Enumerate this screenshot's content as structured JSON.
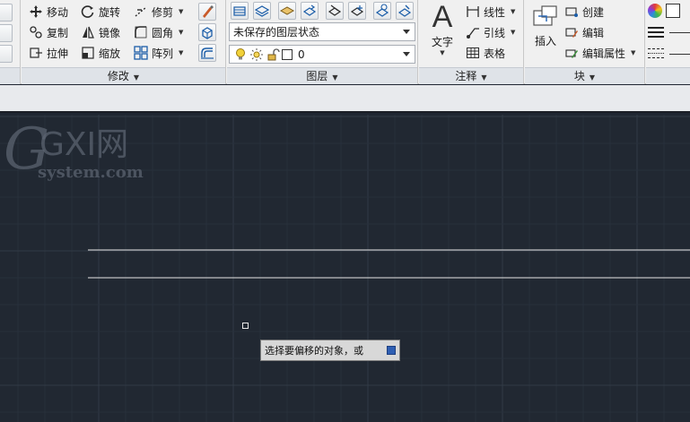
{
  "ribbon": {
    "modify": {
      "title": "修改",
      "tools": {
        "move": "移动",
        "rotate": "旋转",
        "trim": "修剪",
        "copy": "复制",
        "mirror": "镜像",
        "fillet": "圆角",
        "stretch": "拉伸",
        "scale": "缩放",
        "array": "阵列"
      }
    },
    "layers": {
      "title": "图层",
      "state_combo": "未保存的图层状态",
      "layer_combo": "0"
    },
    "annotation": {
      "title": "注释",
      "text": "文字",
      "linear": "线性",
      "leader": "引线",
      "table": "表格"
    },
    "block": {
      "title": "块",
      "insert": "插入",
      "create": "创建",
      "edit": "编辑",
      "edit_attributes": "编辑属性"
    }
  },
  "canvas": {
    "watermark_text": "GXI网",
    "watermark_sub": "system.com",
    "command_prompt": "选择要偏移的对象，或"
  },
  "colors": {
    "canvas_bg": "#212832",
    "grid_minor": "#28303b",
    "grid_major": "#313a46",
    "line": "#e6e6e6"
  }
}
